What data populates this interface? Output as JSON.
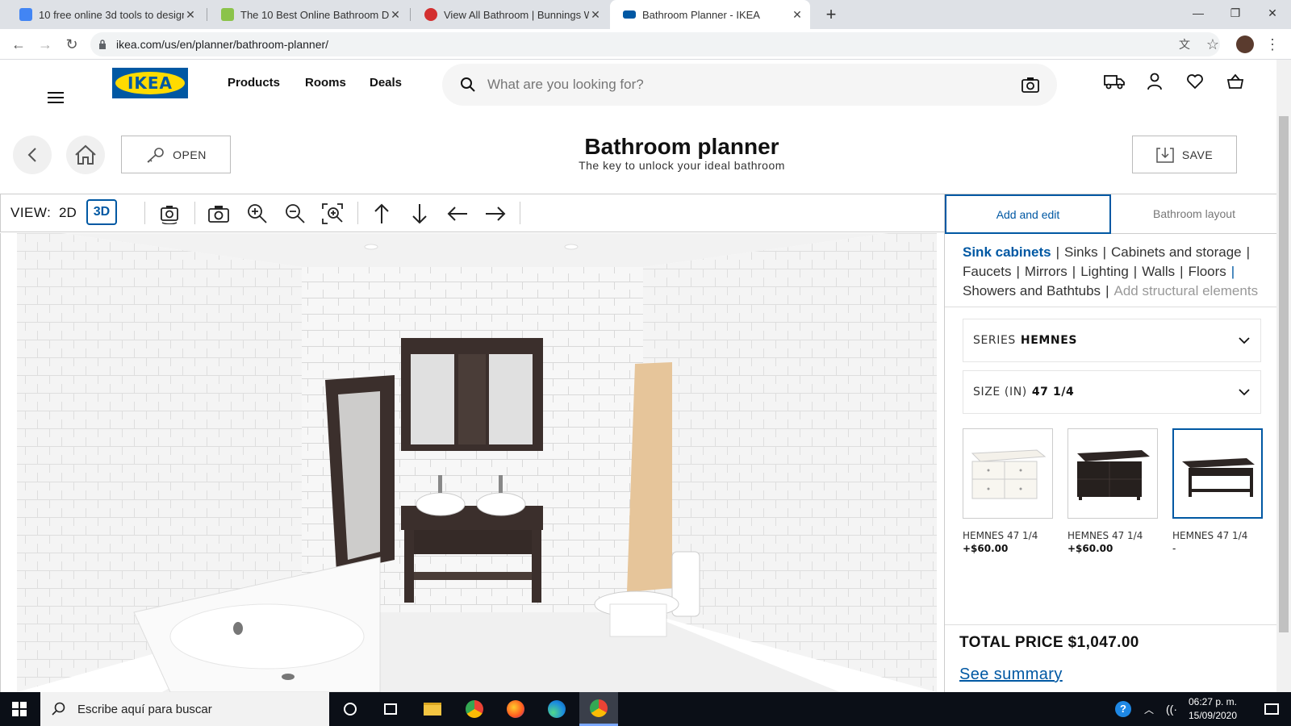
{
  "browser": {
    "tabs": [
      {
        "title": "10 free online 3d tools to design",
        "color": "#4285f4"
      },
      {
        "title": "The 10 Best Online Bathroom De",
        "color": "#8bc34a"
      },
      {
        "title": "View All Bathroom | Bunnings Wa",
        "color": "#d32f2f"
      },
      {
        "title": "Bathroom Planner - IKEA",
        "color": "#0058a3"
      }
    ],
    "new_tab": "+",
    "url": "ikea.com/us/en/planner/bathroom-planner/"
  },
  "header": {
    "logo": "IKEA",
    "nav": [
      "Products",
      "Rooms",
      "Deals"
    ],
    "search_placeholder": "What are you looking for?"
  },
  "planner": {
    "title": "Bathroom planner",
    "subtitle": "The key to unlock your ideal bathroom",
    "open_label": "OPEN",
    "save_label": "SAVE"
  },
  "toolbar": {
    "view_label": "VIEW:",
    "view_2d": "2D",
    "view_3d": "3D"
  },
  "panel": {
    "tab_add": "Add and edit",
    "tab_layout": "Bathroom layout",
    "categories": {
      "selected": "Sink cabinets",
      "items": [
        "Sinks",
        "Cabinets and storage",
        "Faucets",
        "Mirrors",
        "Lighting",
        "Walls",
        "Floors",
        "Showers and Bathtubs"
      ],
      "dim": "Add structural elements"
    },
    "series_label": "SERIES",
    "series_value": "HEMNES",
    "size_label": "SIZE (IN)",
    "size_value": "47 1/4",
    "products": [
      {
        "name": "HEMNES 47 1/4",
        "price": "+$60.00"
      },
      {
        "name": "HEMNES 47 1/4",
        "price": "+$60.00"
      },
      {
        "name": "HEMNES 47 1/4",
        "price": "-"
      }
    ],
    "total": "TOTAL PRICE $1,047.00",
    "summary": "See summary"
  },
  "taskbar": {
    "search_placeholder": "Escribe aquí para buscar",
    "time": "06:27 p. m.",
    "date": "15/09/2020"
  }
}
